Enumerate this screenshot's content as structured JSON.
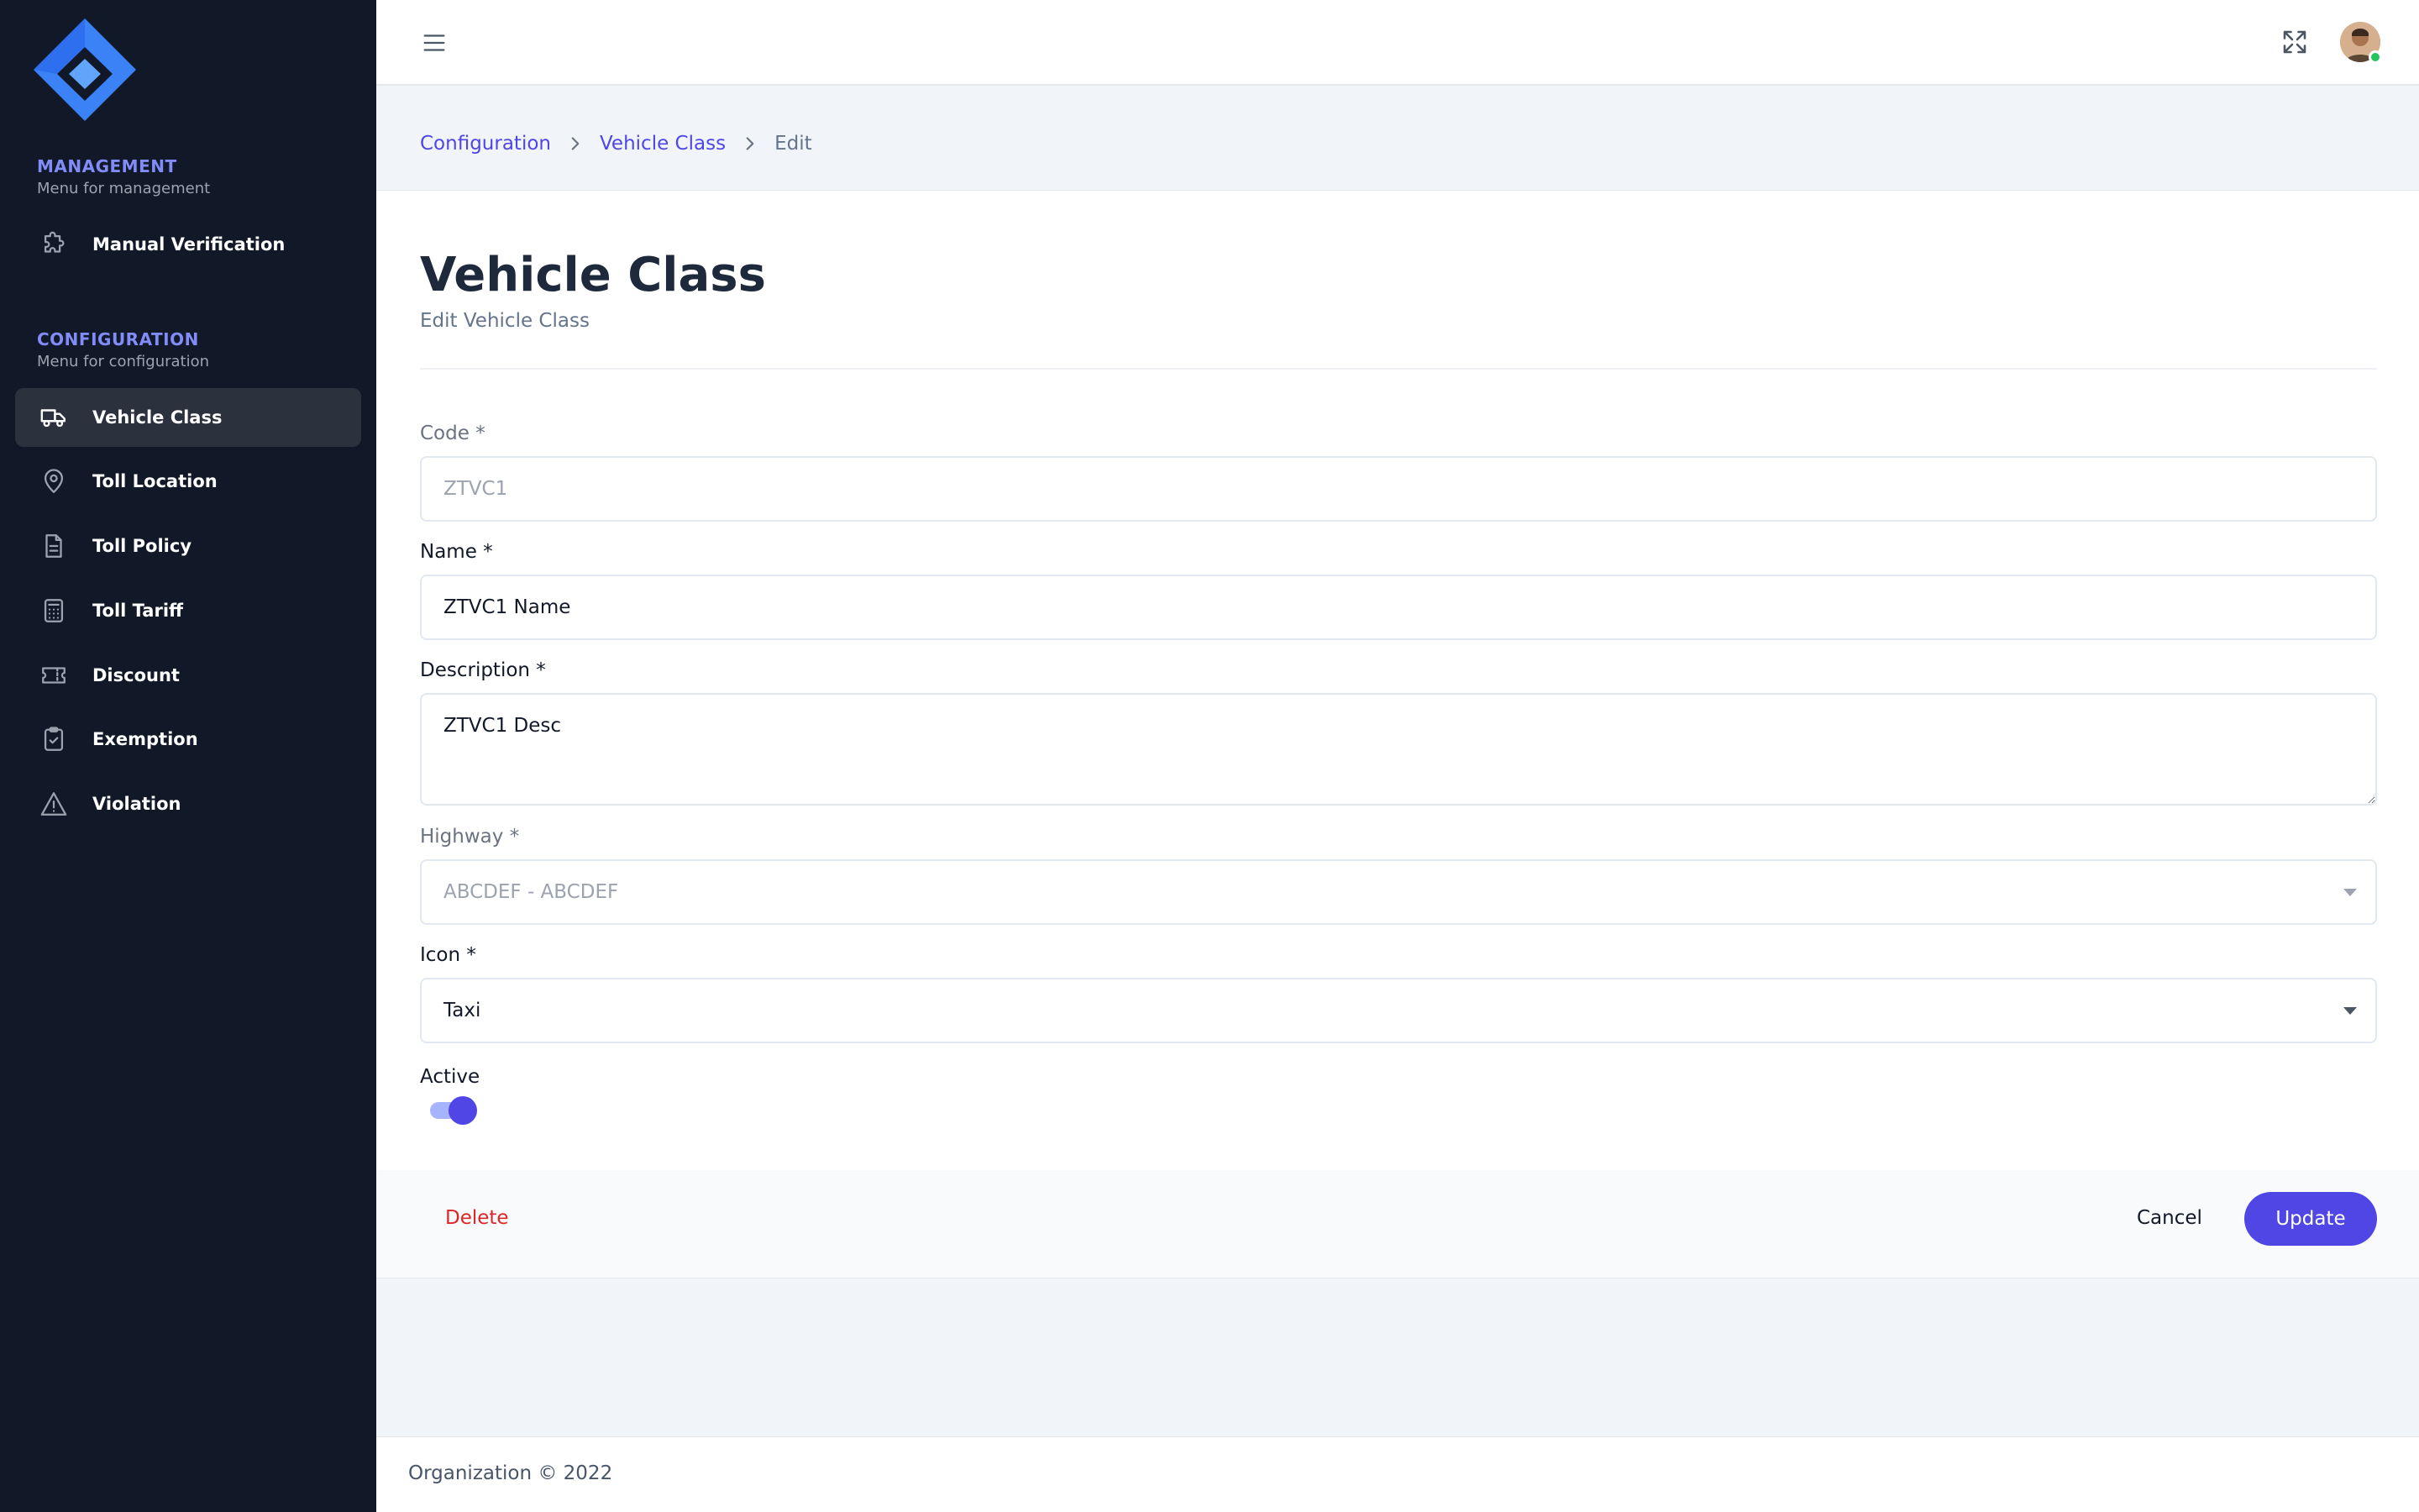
{
  "sidebar": {
    "logo": "diamond-logo",
    "sections": [
      {
        "title": "MANAGEMENT",
        "subtitle": "Menu for management",
        "items": [
          {
            "label": "Manual Verification",
            "icon": "puzzle-icon",
            "active": false
          }
        ]
      },
      {
        "title": "CONFIGURATION",
        "subtitle": "Menu for configuration",
        "items": [
          {
            "label": "Vehicle Class",
            "icon": "truck-icon",
            "active": true
          },
          {
            "label": "Toll Location",
            "icon": "map-pin-icon",
            "active": false
          },
          {
            "label": "Toll Policy",
            "icon": "document-icon",
            "active": false
          },
          {
            "label": "Toll Tariff",
            "icon": "calculator-icon",
            "active": false
          },
          {
            "label": "Discount",
            "icon": "ticket-icon",
            "active": false
          },
          {
            "label": "Exemption",
            "icon": "clipboard-check-icon",
            "active": false
          },
          {
            "label": "Violation",
            "icon": "warning-icon",
            "active": false
          }
        ]
      }
    ]
  },
  "topbar": {
    "menu_icon": "hamburger-icon",
    "fullscreen_icon": "expand-icon",
    "avatar_status": "online"
  },
  "breadcrumb": [
    "Configuration",
    "Vehicle Class",
    "Edit"
  ],
  "page": {
    "title": "Vehicle Class",
    "subtitle": "Edit Vehicle Class"
  },
  "form": {
    "code": {
      "label": "Code *",
      "value": "ZTVC1",
      "disabled": true
    },
    "name": {
      "label": "Name *",
      "value": "ZTVC1 Name"
    },
    "description": {
      "label": "Description *",
      "value": "ZTVC1 Desc"
    },
    "highway": {
      "label": "Highway *",
      "value": "ABCDEF - ABCDEF",
      "disabled": true
    },
    "icon": {
      "label": "Icon *",
      "value": "Taxi"
    },
    "active": {
      "label": "Active",
      "value": true
    }
  },
  "actions": {
    "delete": "Delete",
    "cancel": "Cancel",
    "update": "Update"
  },
  "footer": {
    "text": "Organization © 2022"
  },
  "colors": {
    "sidebar_bg": "#111827",
    "accent": "#4f46e5",
    "danger": "#dc2626"
  }
}
